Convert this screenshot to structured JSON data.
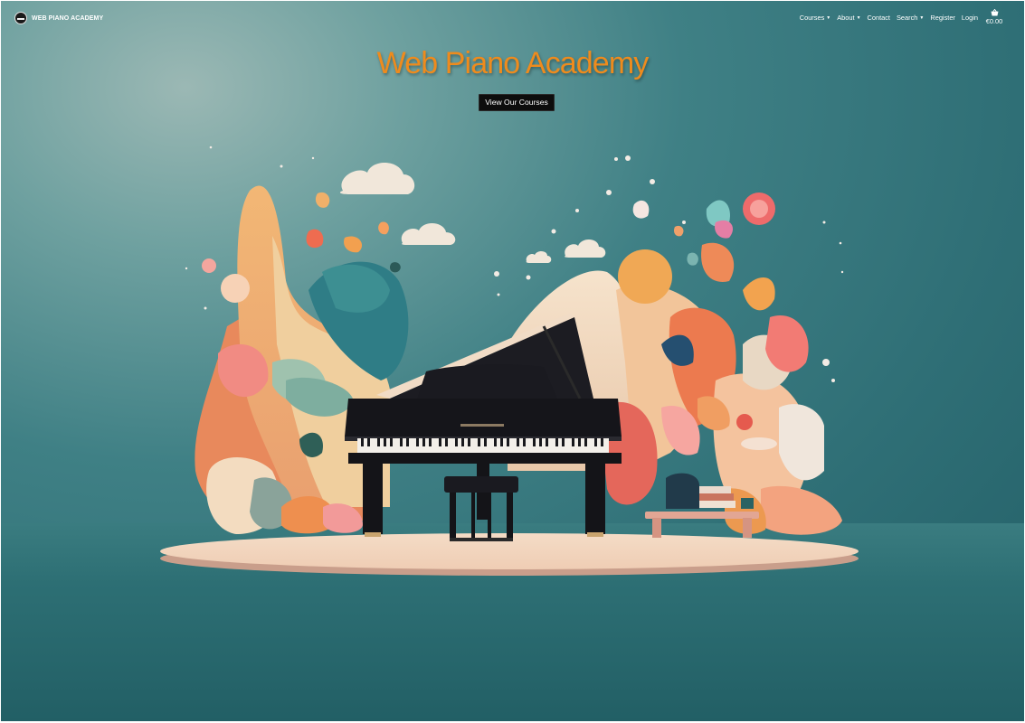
{
  "brand": {
    "name": "WEB PIANO ACADEMY",
    "logo_icon": "piano-logo-icon"
  },
  "nav": {
    "items": [
      {
        "label": "Courses",
        "has_dropdown": true
      },
      {
        "label": "About",
        "has_dropdown": true
      },
      {
        "label": "Contact",
        "has_dropdown": false
      },
      {
        "label": "Search",
        "has_dropdown": true
      },
      {
        "label": "Register",
        "has_dropdown": false
      },
      {
        "label": "Login",
        "has_dropdown": false
      }
    ],
    "cart": {
      "icon": "shopping-basket-icon",
      "total": "€0.00"
    }
  },
  "hero": {
    "title": "Web Piano Academy",
    "button_label": "View Our Courses",
    "image": "illustrated grand piano with piano bench on round stage surrounded by paper-cut flowers, leaves and clouds"
  },
  "colors": {
    "title": "#ee8b1d",
    "background": "#2f6f76",
    "button_bg": "#0d0d0d",
    "nav_text": "#ffffff"
  }
}
